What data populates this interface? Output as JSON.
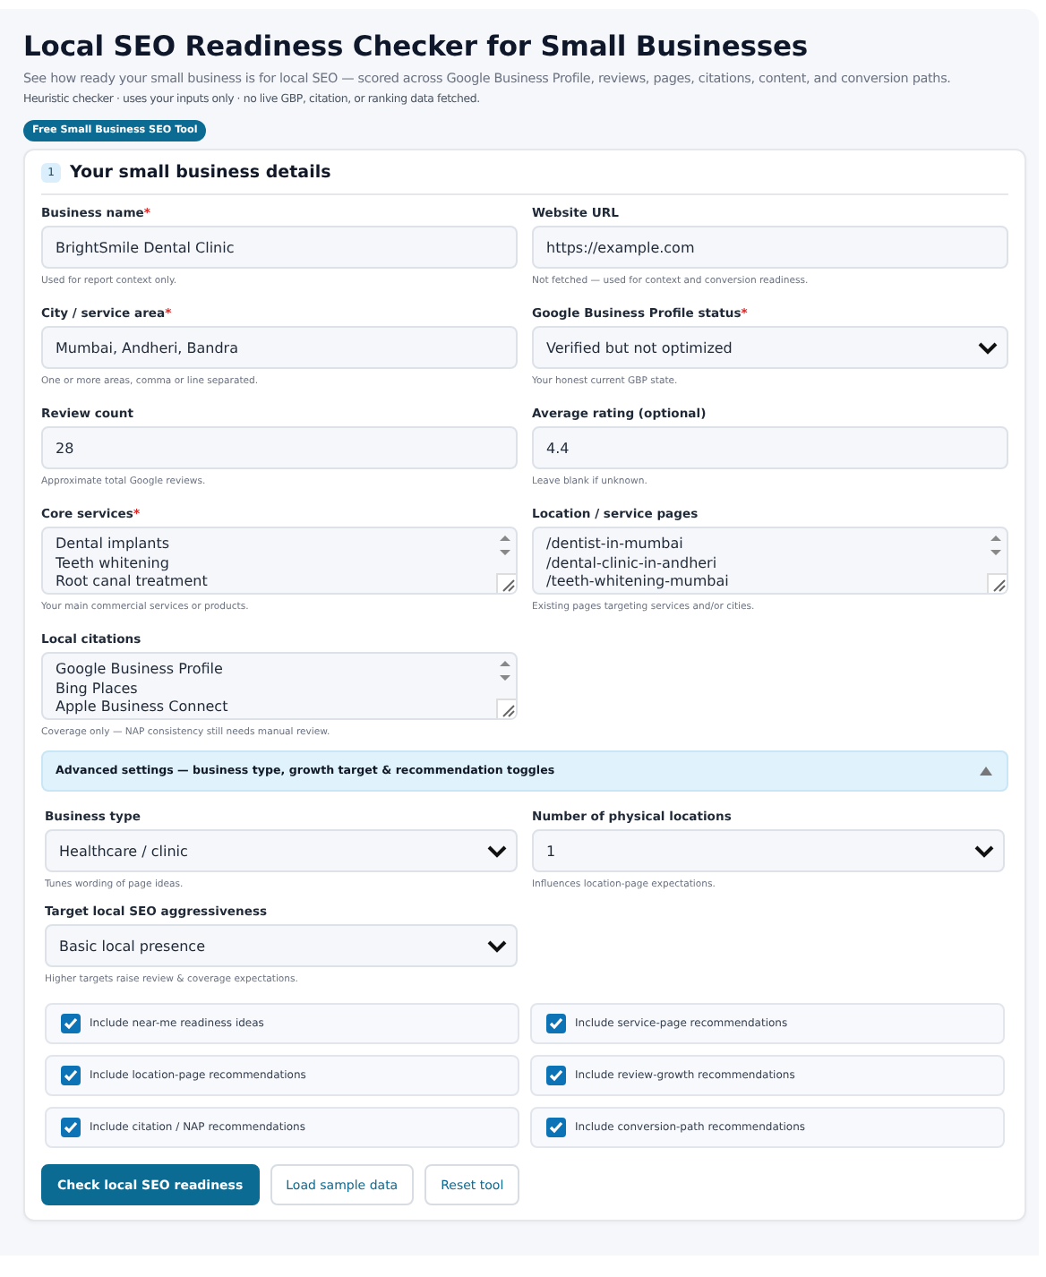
{
  "header": {
    "title": "Local SEO Readiness Checker for Small Businesses",
    "subtitle": "See how ready your small business is for local SEO — scored across Google Business Profile, reviews, pages, citations, content, and conversion paths.",
    "note": "Heuristic checker · uses your inputs only · no live GBP, citation, or ranking data fetched.",
    "badge": "Free Small Business SEO Tool"
  },
  "section": {
    "number": "1",
    "title": "Your small business details"
  },
  "fields": [
    {
      "kind": "text",
      "label": "Business name",
      "marker": "*",
      "value": "BrightSmile Dental Clinic",
      "hint": "Used for report context only."
    },
    {
      "kind": "text",
      "label": "Website URL",
      "value": "https://example.com",
      "hint": "Not fetched — used for context and conversion readiness."
    },
    {
      "kind": "text",
      "label": "City / service area",
      "marker": "*",
      "value": "Mumbai, Andheri, Bandra",
      "hint": "One or more areas, comma or line separated."
    },
    {
      "kind": "select",
      "label": "Google Business Profile status",
      "marker": "*",
      "value": "Verified but not optimized",
      "hint": "Your honest current GBP state."
    },
    {
      "kind": "text",
      "label": "Review count",
      "value": "28",
      "hint": "Approximate total Google reviews."
    },
    {
      "kind": "text",
      "label": "Average rating (optional)",
      "value": "4.4",
      "hint": "Leave blank if unknown."
    },
    {
      "kind": "textarea",
      "label": "Core services",
      "marker": "*",
      "lines": [
        "Dental implants",
        "Teeth whitening",
        "Root canal treatment"
      ],
      "hint": "Your main commercial services or products."
    },
    {
      "kind": "textarea",
      "label": "Location / service pages",
      "lines": [
        "/dentist-in-mumbai",
        "/dental-clinic-in-andheri",
        "/teeth-whitening-mumbai"
      ],
      "hint": "Existing pages targeting services and/or cities."
    },
    {
      "kind": "textarea",
      "label": "Local citations",
      "lines": [
        "Google Business Profile",
        "Bing Places",
        "Apple Business Connect"
      ],
      "hint": "Coverage only — NAP consistency still needs manual review."
    }
  ],
  "advanced": {
    "title": "Advanced settings — business type, growth target & recommendation toggles",
    "expanded": true,
    "fields": [
      {
        "kind": "select",
        "label": "Business type",
        "value": "Healthcare / clinic",
        "hint": "Tunes wording of page ideas."
      },
      {
        "kind": "select",
        "label": "Number of physical locations",
        "value": "1",
        "hint": "Influences location-page expectations."
      },
      {
        "kind": "select",
        "label": "Target local SEO aggressiveness",
        "value": "Basic local presence",
        "hint": "Higher targets raise review & coverage expectations."
      }
    ],
    "options": [
      {
        "label": "Include near-me readiness ideas",
        "checked": true
      },
      {
        "label": "Include service-page recommendations",
        "checked": true
      },
      {
        "label": "Include location-page recommendations",
        "checked": true
      },
      {
        "label": "Include review-growth recommendations",
        "checked": true
      },
      {
        "label": "Include citation / NAP recommendations",
        "checked": true
      },
      {
        "label": "Include conversion-path recommendations",
        "checked": true
      }
    ]
  },
  "buttons": [
    {
      "kind": "primary",
      "label": "Check local SEO readiness"
    },
    {
      "kind": "secondary",
      "label": "Load sample data"
    },
    {
      "kind": "secondary",
      "label": "Reset tool"
    }
  ]
}
